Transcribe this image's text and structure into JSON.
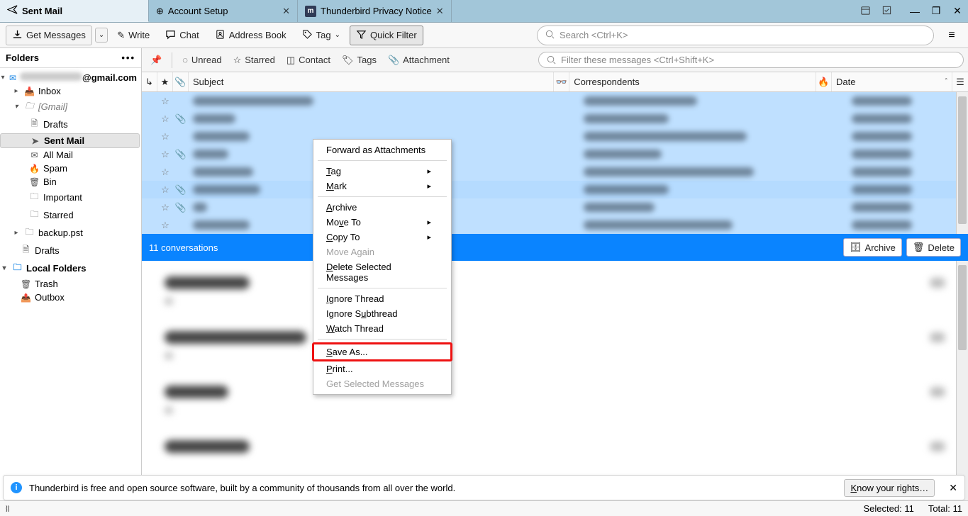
{
  "tabs": [
    {
      "label": "Sent Mail",
      "icon": "send-icon",
      "active": true
    },
    {
      "label": "Account Setup",
      "icon": "globe-icon",
      "close": true
    },
    {
      "label": "Thunderbird Privacy Notice",
      "icon": "m-icon",
      "close": true
    }
  ],
  "toolbar": {
    "getMessages": "Get Messages",
    "write": "Write",
    "chat": "Chat",
    "addressBook": "Address Book",
    "tag": "Tag",
    "quickFilter": "Quick Filter",
    "searchPlaceholder": "Search <Ctrl+K>"
  },
  "folderPane": {
    "header": "Folders",
    "tree": {
      "account": "@gmail.com",
      "inbox": "Inbox",
      "gmail": "[Gmail]",
      "drafts": "Drafts",
      "sentMail": "Sent Mail",
      "allMail": "All Mail",
      "spam": "Spam",
      "bin": "Bin",
      "important": "Important",
      "starred": "Starred",
      "backup": "backup.pst",
      "drafts2": "Drafts",
      "local": "Local Folders",
      "trash": "Trash",
      "outbox": "Outbox"
    }
  },
  "filterBar": {
    "unread": "Unread",
    "starred": "Starred",
    "contact": "Contact",
    "tags": "Tags",
    "attachment": "Attachment",
    "filterPlaceholder": "Filter these messages <Ctrl+Shift+K>"
  },
  "columns": {
    "subject": "Subject",
    "correspondents": "Correspondents",
    "date": "Date"
  },
  "conversationBar": {
    "title": "11 conversations",
    "archive": "Archive",
    "delete": "Delete"
  },
  "contextMenu": {
    "forwardAtt": "Forward as Attachments",
    "tag": "Tag",
    "mark": "Mark",
    "archive": "Archive",
    "moveTo": "Move To",
    "copyTo": "Copy To",
    "moveAgain": "Move Again",
    "deleteSel": "Delete Selected Messages",
    "ignoreThread": "Ignore Thread",
    "ignoreSub": "Ignore Subthread",
    "watch": "Watch Thread",
    "saveAs": "Save As...",
    "print": "Print...",
    "getSel": "Get Selected Messages"
  },
  "notice": {
    "text": "Thunderbird is free and open source software, built by a community of thousands from all over the world.",
    "know": "Know your rights…"
  },
  "status": {
    "selected": "Selected: 11",
    "total": "Total: 11"
  }
}
